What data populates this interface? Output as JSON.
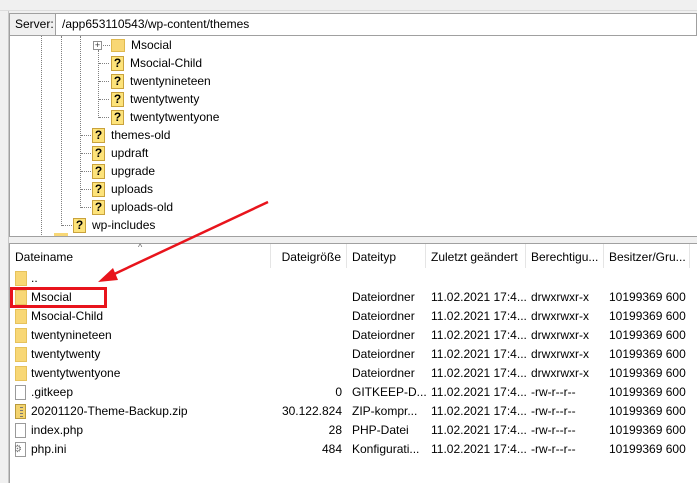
{
  "server": {
    "label": "Server:",
    "path": "/app653110543/wp-content/themes"
  },
  "tree": {
    "level3": [
      {
        "name": "Msocial",
        "icon": "folder",
        "expandable": true
      },
      {
        "name": "Msocial-Child",
        "icon": "unknown"
      },
      {
        "name": "twentynineteen",
        "icon": "unknown"
      },
      {
        "name": "twentytwenty",
        "icon": "unknown"
      },
      {
        "name": "twentytwentyone",
        "icon": "unknown"
      }
    ],
    "level2": [
      {
        "name": "themes-old"
      },
      {
        "name": "updraft"
      },
      {
        "name": "upgrade"
      },
      {
        "name": "uploads"
      },
      {
        "name": "uploads-old"
      }
    ],
    "level1": [
      {
        "name": "wp-includes"
      }
    ]
  },
  "list": {
    "columns": [
      "Dateiname",
      "Dateigröße",
      "Dateityp",
      "Zuletzt geändert",
      "Berechtigu...",
      "Besitzer/Gru..."
    ],
    "rows": [
      {
        "name": "..",
        "size": "",
        "type": "",
        "modified": "",
        "perms": "",
        "owner": "",
        "icon": "folder"
      },
      {
        "name": "Msocial",
        "size": "",
        "type": "Dateiordner",
        "modified": "11.02.2021 17:4...",
        "perms": "drwxrwxr-x",
        "owner": "10199369 600",
        "icon": "folder"
      },
      {
        "name": "Msocial-Child",
        "size": "",
        "type": "Dateiordner",
        "modified": "11.02.2021 17:4...",
        "perms": "drwxrwxr-x",
        "owner": "10199369 600",
        "icon": "folder"
      },
      {
        "name": "twentynineteen",
        "size": "",
        "type": "Dateiordner",
        "modified": "11.02.2021 17:4...",
        "perms": "drwxrwxr-x",
        "owner": "10199369 600",
        "icon": "folder"
      },
      {
        "name": "twentytwenty",
        "size": "",
        "type": "Dateiordner",
        "modified": "11.02.2021 17:4...",
        "perms": "drwxrwxr-x",
        "owner": "10199369 600",
        "icon": "folder"
      },
      {
        "name": "twentytwentyone",
        "size": "",
        "type": "Dateiordner",
        "modified": "11.02.2021 17:4...",
        "perms": "drwxrwxr-x",
        "owner": "10199369 600",
        "icon": "folder"
      },
      {
        "name": ".gitkeep",
        "size": "0",
        "type": "GITKEEP-D...",
        "modified": "11.02.2021 17:4...",
        "perms": "-rw-r--r--",
        "owner": "10199369 600",
        "icon": "file"
      },
      {
        "name": "20201120-Theme-Backup.zip",
        "size": "30.122.824",
        "type": "ZIP-kompr...",
        "modified": "11.02.2021 17:4...",
        "perms": "-rw-r--r--",
        "owner": "10199369 600",
        "icon": "zip"
      },
      {
        "name": "index.php",
        "size": "28",
        "type": "PHP-Datei",
        "modified": "11.02.2021 17:4...",
        "perms": "-rw-r--r--",
        "owner": "10199369 600",
        "icon": "file"
      },
      {
        "name": "php.ini",
        "size": "484",
        "type": "Konfigurati...",
        "modified": "11.02.2021 17:4...",
        "perms": "-rw-r--r--",
        "owner": "10199369 600",
        "icon": "config"
      }
    ]
  },
  "annotation": {
    "color": "#e8141c",
    "highlighted": "Msocial"
  }
}
